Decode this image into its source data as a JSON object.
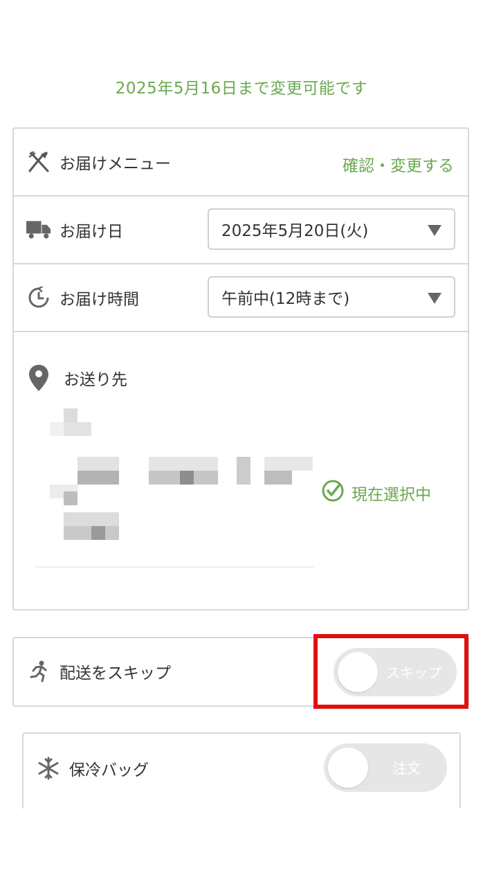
{
  "deadline_text": "2025年5月16日まで変更可能です",
  "menu": {
    "label": "お届けメニュー",
    "icon": "fork-knife-icon",
    "action": "確認・変更する"
  },
  "date": {
    "label": "お届け日",
    "icon": "truck-icon",
    "selected": "2025年5月20日(火)"
  },
  "time": {
    "label": "お届け時間",
    "icon": "clock-icon",
    "selected": "午前中(12時まで)"
  },
  "address": {
    "label": "お送り先",
    "icon": "location-pin-icon",
    "status": "現在選択中",
    "status_icon": "check-circle-icon"
  },
  "skip": {
    "label": "配送をスキップ",
    "icon": "running-person-icon",
    "toggle_label": "スキップ",
    "on": false
  },
  "cool_bag": {
    "label": "保冷バッグ",
    "icon": "snowflake-icon",
    "toggle_label": "注文",
    "on": false
  },
  "colors": {
    "accent": "#6aa84f",
    "highlight": "#e01010",
    "border": "#d7d7d7",
    "toggle_off": "#e6e6e6"
  }
}
